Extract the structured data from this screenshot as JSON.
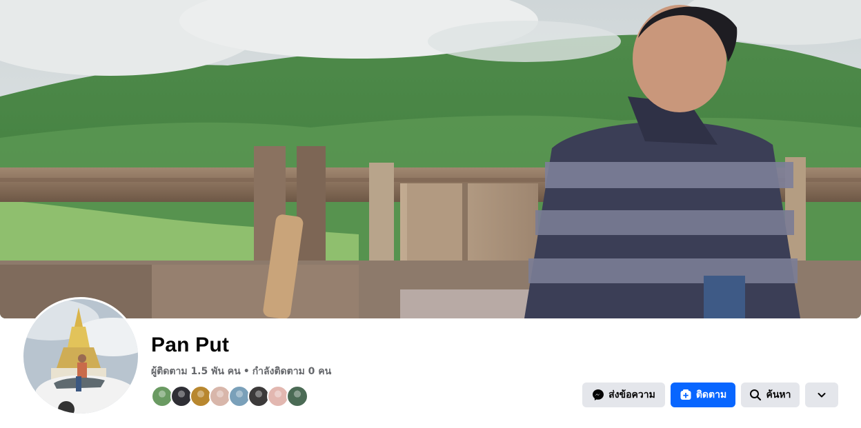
{
  "profile": {
    "name": "Pan Put",
    "followers_text": "ผู้ติดตาม 1.5 พัน คน",
    "separator": "•",
    "following_text": "กำลังติดตาม 0 คน"
  },
  "follower_avatars": [
    {
      "color": "#6a9a62"
    },
    {
      "color": "#2f2f35"
    },
    {
      "color": "#b8872f"
    },
    {
      "color": "#d8b6aa"
    },
    {
      "color": "#7aa0b9"
    },
    {
      "color": "#3c3a3a"
    },
    {
      "color": "#e2b7b0"
    },
    {
      "color": "#4b6b55"
    }
  ],
  "actions": {
    "message_label": "ส่งข้อความ",
    "follow_label": "ติดตาม",
    "search_label": "ค้นหา"
  },
  "icons": {
    "message": "messenger-icon",
    "follow": "follow-plus-icon",
    "search": "search-icon",
    "more": "chevron-down-icon"
  },
  "colors": {
    "primary_button": "#0866ff",
    "secondary_button": "#e4e6eb",
    "name_text": "#050505",
    "meta_text": "#65676b"
  }
}
